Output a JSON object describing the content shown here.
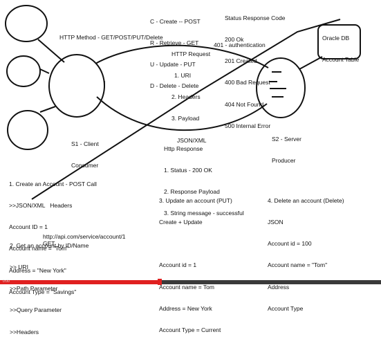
{
  "diagram": {
    "http_method_title": "HTTP Method - GET/POST/PUT/Delete",
    "crud": [
      "C - Create -- POST",
      "R - Retrieve - GET",
      "U - Update - PUT",
      "D - Delete - Delete"
    ],
    "status_codes": {
      "title": "Status Response Code",
      "items": [
        "200 Ok",
        "201 Created",
        "400 Bad Request",
        "404 Not Found",
        "500 Internal Error"
      ],
      "extra": "401 - authentication"
    },
    "oracle_db": [
      "Oracle DB",
      "Account Table"
    ],
    "http_request": [
      "HTTP Request",
      "1. URI",
      "2. Headers",
      "3. Payload",
      "JSON/XML"
    ],
    "client": [
      "S1 - Client",
      "Consumer"
    ],
    "server": [
      "S2 - Server",
      "Producer"
    ],
    "http_response": [
      "Http Response",
      "1. Status - 200 OK",
      "2. Response Payload",
      "3. String message - successful"
    ],
    "create_account": [
      "1. Create an Account - POST Call",
      ">>JSON/XML   Headers",
      "Account ID = 1",
      "Account name = \"Tom\"",
      "Address = \"New York\"",
      "Account Type = \"Savings\""
    ],
    "get_account": [
      "2. Get an account by ID/Name",
      ">> URI",
      ">>Path Parameter",
      ">>Query Parameter",
      ">>Headers"
    ],
    "get_url": "http://api.com/service/account/1",
    "get_verb": "GET",
    "update_account": [
      "3. Update an account (PUT)",
      "Create + Update",
      "",
      "Account id = 1",
      "Account name = Tom",
      "Address = New York",
      "Account Type = Current"
    ],
    "delete_account": [
      "4. Delete an account (Delete)",
      "JSON",
      "Account id = 100",
      "Account name = \"Tom\"",
      "Address",
      "Account Type"
    ],
    "cursor_glyph": "I"
  },
  "player": {
    "progress_fraction": 0.42,
    "time_label": "0:00"
  },
  "colors": {
    "ink": "#111111",
    "progress_played": "#e02020",
    "progress_track": "#3a3a3a"
  }
}
